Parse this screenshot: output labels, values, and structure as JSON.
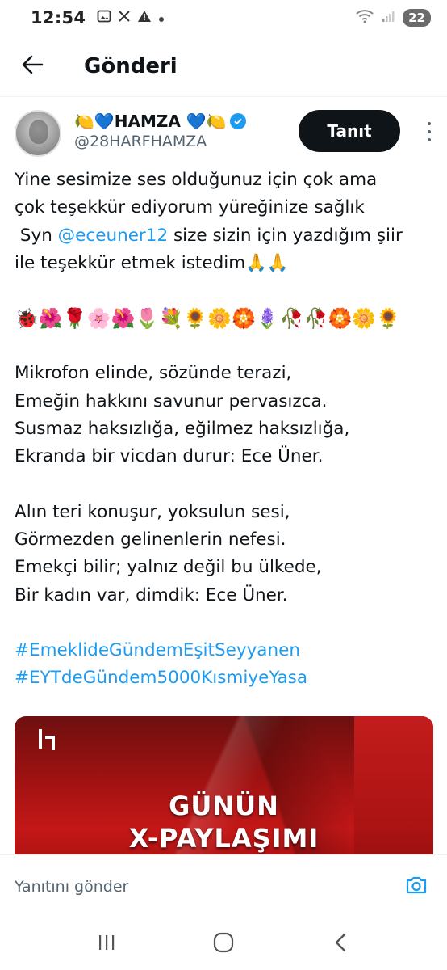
{
  "status_bar": {
    "time": "12:54",
    "left_icons": [
      "gallery-icon",
      "x-logo-icon",
      "warning-icon",
      "dot-icon"
    ],
    "battery": "22"
  },
  "header": {
    "title": "Gönderi",
    "back_icon": "arrow-left-icon"
  },
  "post": {
    "author": {
      "display_name": "🍋💙HAMZA 💙🍋",
      "handle": "@28HARFHAMZA",
      "verified": true
    },
    "follow_label": "Tanıt",
    "text": {
      "line1": "Yine sesimize ses olduğunuz için çok ama",
      "line2": "çok teşekkür ediyorum yüreğinize sağlık",
      "line3_prefix": " Syn ",
      "mention": "@eceuner12",
      "line3_suffix": " size sizin için yazdığım şiir",
      "line4": "ile teşekkür etmek istedim🙏🙏",
      "emoji_line": "🐞🌺🌹🌸🌺🌷💐🌻🌼🏵️🪻🥀🥀🏵️🌼🌻",
      "stanza1": [
        "Mikrofon elinde, sözünde terazi,",
        "Emeğin hakkını savunur pervasızca.",
        "Susmaz haksızlığa, eğilmez haksızlığa,",
        "Ekranda bir vicdan durur: Ece Üner."
      ],
      "stanza2": [
        "Alın teri konuşur, yoksulun sesi,",
        "Görmezden gelinenlerin nefesi.",
        "Emekçi bilir; yalnız değil bu ülkede,",
        "Bir kadın var, dimdik: Ece Üner."
      ],
      "hashtags": [
        "#EmeklideGündemEşitSeyyanen",
        "#EYTdeGündem5000KısmiyeYasa"
      ]
    },
    "media": {
      "line1": "GÜNÜN",
      "line2": "X-PAYLAŞIMI"
    }
  },
  "reply": {
    "placeholder": "Yanıtını gönder"
  },
  "colors": {
    "accent": "#1d9bf0",
    "text": "#0f1419",
    "secondary": "#536471",
    "button_bg": "#0f1419"
  }
}
